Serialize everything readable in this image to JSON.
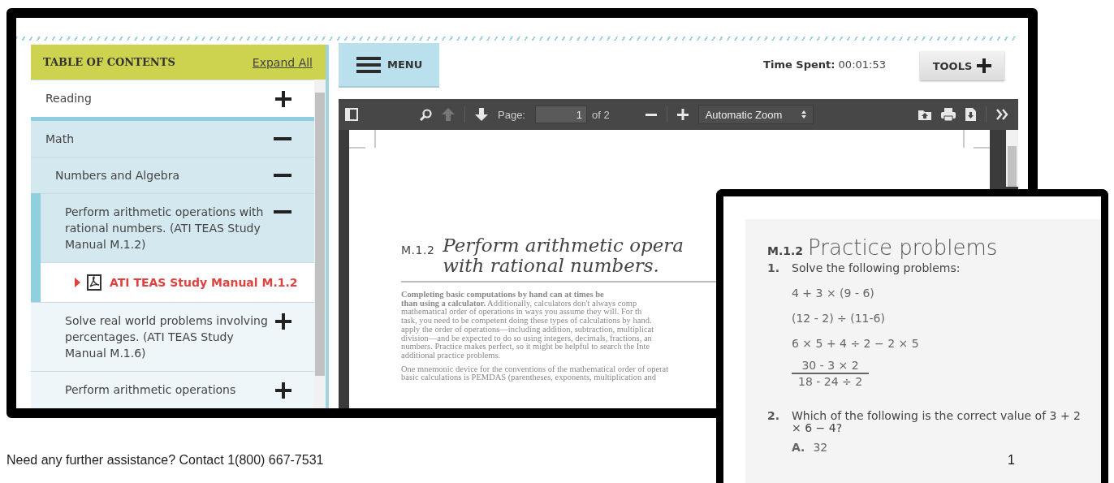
{
  "toc": {
    "title": "TABLE OF CONTENTS",
    "expand_link": "Expand All",
    "items": [
      {
        "label": "Reading",
        "kind": "section",
        "expanded": false,
        "selected": false
      },
      {
        "label": "Math",
        "kind": "section",
        "expanded": true,
        "selected": false,
        "children": [
          {
            "label": "Numbers and Algebra",
            "kind": "section",
            "expanded": true,
            "selected": false,
            "children": [
              {
                "label": "Perform arithmetic operations with rational numbers. (ATI TEAS Study Manual M.1.2)",
                "kind": "section",
                "expanded": true,
                "selected": false,
                "children": [
                  {
                    "label": "ATI TEAS Study Manual M.1.2",
                    "kind": "pdf",
                    "selected": true
                  }
                ]
              },
              {
                "label": "Solve real world problems involving percentages. (ATI TEAS Study Manual M.1.6)",
                "kind": "section",
                "expanded": false,
                "selected": false
              },
              {
                "label": "Perform arithmetic operations",
                "kind": "section",
                "expanded": false,
                "selected": false
              }
            ]
          }
        ]
      }
    ]
  },
  "header": {
    "menu_button": "MENU",
    "time_label": "Time Spent:",
    "time_value": "00:01:53",
    "tools_button": "TOOLS"
  },
  "pdf_toolbar": {
    "page_label": "Page:",
    "page_value": "1",
    "page_total": "of 2",
    "zoom": "Automatic Zoom"
  },
  "document": {
    "section_number": "M.1.2",
    "title_lines": [
      "Perform arithmetic opera",
      "with rational numbers."
    ],
    "paragraphs": [
      [
        "**Completing basic computations by hand can at times be**",
        "**than using a calculator.** Additionally, calculators don't always comp",
        "mathematical order of operations in ways you assume they will. For th",
        "task, you need to be competent doing these types of calculations by hand.",
        "apply the order of operations—including addition, subtraction, multiplicat",
        "division—and be expected to do so using integers, decimals, fractions, an",
        "numbers. Practice makes perfect, so it might be helpful to search the Inte",
        "additional practice problems."
      ],
      [
        "One mnemonic device for the conventions of the mathematical order of operat",
        "basic calculations is PEMDAS (parentheses, exponents, multiplication and"
      ]
    ]
  },
  "inset": {
    "section_number": "M.1.2",
    "title": "Practice problems",
    "problems": [
      {
        "number": "1.",
        "text": "Solve the following problems:",
        "expressions": [
          {
            "kind": "line",
            "text": "4 + 3 × (9 - 6)"
          },
          {
            "kind": "line",
            "text": "(12 - 2) ÷ (11-6)"
          },
          {
            "kind": "line",
            "text": "6 × 5 + 4 ÷ 2 − 2 × 5"
          },
          {
            "kind": "fraction",
            "numerator": "30 - 3 × 2",
            "denominator": "18 - 24 ÷ 2"
          }
        ]
      },
      {
        "number": "2.",
        "text": "Which of the following is the correct value of 3 + 2 × 6 − 4?",
        "options": [
          {
            "letter": "A.",
            "text": "32"
          }
        ]
      }
    ]
  },
  "footer": {
    "text": "Need any further assistance? Contact 1(800) 667-7531",
    "page_number": "1"
  }
}
